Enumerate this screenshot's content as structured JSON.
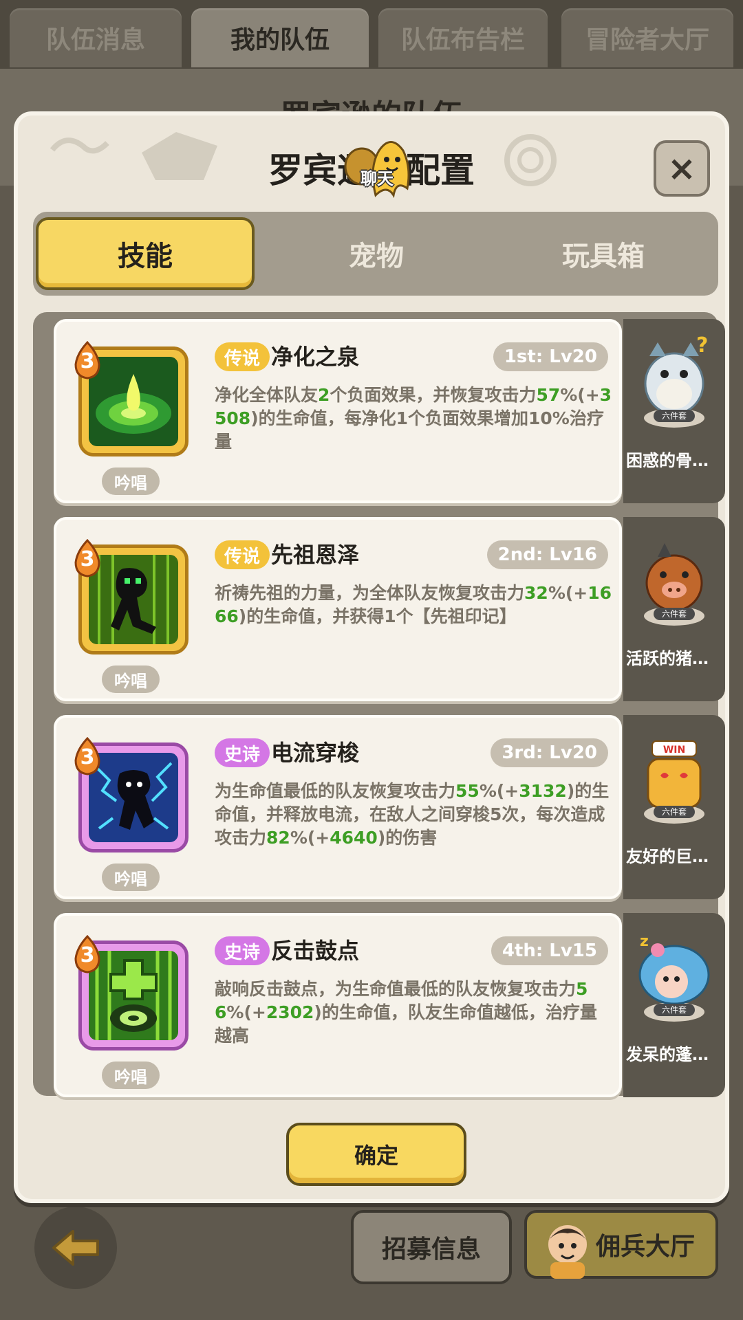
{
  "top_tabs": [
    {
      "label": "队伍消息"
    },
    {
      "label": "我的队伍"
    },
    {
      "label": "队伍布告栏"
    },
    {
      "label": "冒险者大厅"
    }
  ],
  "background": {
    "page_title": "罗宾逊的队伍",
    "recruit_label": "招募信息",
    "mercenary_label": "佣兵大厅"
  },
  "modal": {
    "title": "罗宾逊的配置",
    "chat_label": "聊天",
    "close_icon": "×",
    "tabs": [
      {
        "label": "技能"
      },
      {
        "label": "宠物"
      },
      {
        "label": "玩具箱"
      }
    ],
    "confirm_label": "确定"
  },
  "skills": [
    {
      "level": "3",
      "rarity": "传说",
      "name": "净化之泉",
      "slot": "1st: Lv20",
      "type": "吟唱",
      "desc_parts": [
        "净化全体队友",
        "2",
        "个负面效果，并恢复攻击力",
        "57",
        "%(+",
        "3508",
        ")的生命值，每净化1个负面效果增加10%治疗量"
      ],
      "pet_name": "困惑的骨…",
      "pet_badge": "六件套"
    },
    {
      "level": "3",
      "rarity": "传说",
      "name": "先祖恩泽",
      "slot": "2nd: Lv16",
      "type": "吟唱",
      "desc_parts": [
        "祈祷先祖的力量，为全体队友恢复攻击力",
        "32",
        "%(+",
        "1666",
        ")的生命值，并获得1个【先祖印记】"
      ],
      "pet_name": "活跃的猪…",
      "pet_badge": "六件套"
    },
    {
      "level": "3",
      "rarity": "史诗",
      "name": "电流穿梭",
      "slot": "3rd: Lv20",
      "type": "吟唱",
      "desc_parts": [
        "为生命值最低的队友恢复攻击力",
        "55",
        "%(+",
        "3132",
        ")的生命值，并释放电流，在敌人之间穿梭5次，每次造成攻击力",
        "82",
        "%(+",
        "4640",
        ")的伤害"
      ],
      "pet_name": "友好的巨…",
      "pet_badge": "六件套"
    },
    {
      "level": "3",
      "rarity": "史诗",
      "name": "反击鼓点",
      "slot": "4th: Lv15",
      "type": "吟唱",
      "desc_parts": [
        "敲响反击鼓点，为生命值最低的队友恢复攻击力",
        "56",
        "%(+",
        "2302",
        ")的生命值，队友生命值越低，治疗量越高"
      ],
      "pet_name": "发呆的蓬…",
      "pet_badge": "六件套"
    }
  ],
  "colors": {
    "accent_yellow": "#f7d763",
    "legend": "#f3c23a",
    "epic": "#d477e5",
    "green_value": "#3d9e24"
  }
}
